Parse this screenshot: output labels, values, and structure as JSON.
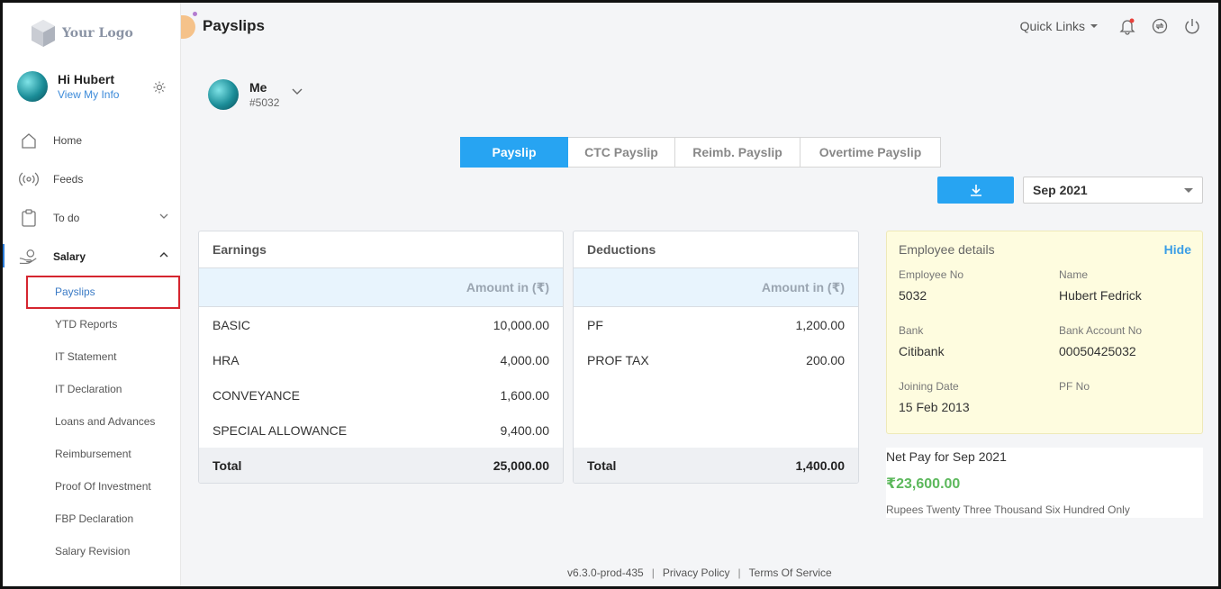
{
  "sidebar": {
    "logo_text": "Your Logo",
    "greeting": "Hi Hubert",
    "view_info": "View My Info",
    "nav": [
      {
        "label": "Home",
        "icon": "home-icon"
      },
      {
        "label": "Feeds",
        "icon": "feeds-icon"
      },
      {
        "label": "To do",
        "icon": "clipboard-icon"
      },
      {
        "label": "Salary",
        "icon": "salary-icon"
      }
    ],
    "salary_sub": [
      "Payslips",
      "YTD Reports",
      "IT Statement",
      "IT Declaration",
      "Loans and Advances",
      "Reimbursement",
      "Proof Of Investment",
      "FBP Declaration",
      "Salary Revision"
    ]
  },
  "header": {
    "title": "Payslips",
    "quick_links": "Quick Links"
  },
  "employee": {
    "name": "Me",
    "id": "#5032"
  },
  "tabs": [
    "Payslip",
    "CTC Payslip",
    "Reimb. Payslip",
    "Overtime Payslip"
  ],
  "month": "Sep 2021",
  "earnings": {
    "title": "Earnings",
    "amount_header": "Amount in (₹)",
    "rows": [
      {
        "name": "BASIC",
        "amount": "10,000.00"
      },
      {
        "name": "HRA",
        "amount": "4,000.00"
      },
      {
        "name": "CONVEYANCE",
        "amount": "1,600.00"
      },
      {
        "name": "SPECIAL ALLOWANCE",
        "amount": "9,400.00"
      }
    ],
    "total_label": "Total",
    "total": "25,000.00"
  },
  "deductions": {
    "title": "Deductions",
    "amount_header": "Amount in (₹)",
    "rows": [
      {
        "name": "PF",
        "amount": "1,200.00"
      },
      {
        "name": "PROF TAX",
        "amount": "200.00"
      }
    ],
    "total_label": "Total",
    "total": "1,400.00"
  },
  "details": {
    "title": "Employee details",
    "hide": "Hide",
    "employee_no_label": "Employee No",
    "employee_no": "5032",
    "name_label": "Name",
    "name": "Hubert Fedrick",
    "bank_label": "Bank",
    "bank": "Citibank",
    "account_label": "Bank Account No",
    "account": "00050425032",
    "joining_label": "Joining Date",
    "joining": "15 Feb 2013",
    "pf_label": "PF No",
    "pf": ""
  },
  "netpay": {
    "label": "Net Pay for Sep 2021",
    "amount": "₹23,600.00",
    "words": "Rupees Twenty Three Thousand Six Hundred Only"
  },
  "footer": {
    "version": "v6.3.0-prod-435",
    "privacy": "Privacy Policy",
    "terms": "Terms Of Service"
  },
  "colors": {
    "accent": "#27a4f2",
    "net_pay": "#5cb85c",
    "details_bg": "#fefcdf",
    "highlight_box": "#d5252f"
  }
}
